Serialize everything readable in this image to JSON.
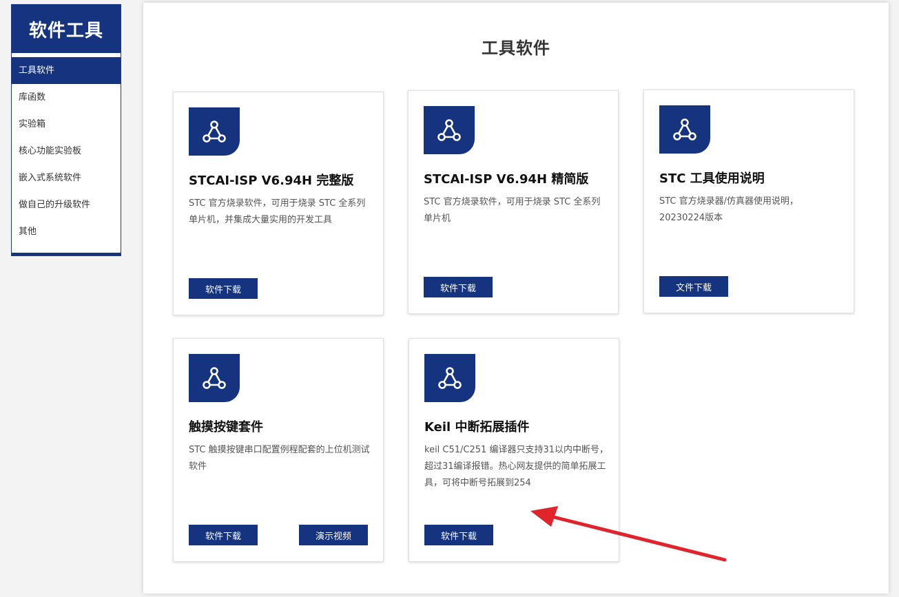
{
  "sidebar": {
    "title": "软件工具",
    "items": [
      {
        "label": "工具软件",
        "active": true
      },
      {
        "label": "库函数"
      },
      {
        "label": "实验箱"
      },
      {
        "label": "核心功能实验板"
      },
      {
        "label": "嵌入式系统软件"
      },
      {
        "label": "做自己的升级软件"
      },
      {
        "label": "其他"
      }
    ]
  },
  "main": {
    "title": "工具软件",
    "cards": [
      {
        "title": "STCAI-ISP V6.94H 完整版",
        "desc": "STC 官方烧录软件，可用于烧录 STC 全系列单片机，并集成大量实用的开发工具",
        "buttons": [
          "软件下载"
        ]
      },
      {
        "title": "STCAI-ISP V6.94H 精简版",
        "desc": "STC 官方烧录软件，可用于烧录 STC 全系列单片机",
        "buttons": [
          "软件下载"
        ]
      },
      {
        "title": "STC 工具使用说明",
        "desc": "STC 官方烧录器/仿真器使用说明，20230224版本",
        "buttons": [
          "文件下载"
        ]
      },
      {
        "title": "触摸按键套件",
        "desc": "STC 触摸按键串口配置例程配套的上位机测试软件",
        "buttons": [
          "软件下载",
          "演示视频"
        ]
      },
      {
        "title": "Keil 中断拓展插件",
        "desc": "keil C51/C251 编译器只支持31以内中断号，超过31编译报错。热心网友提供的简单拓展工具，可将中断号拓展到254",
        "buttons": [
          "软件下载"
        ]
      }
    ]
  },
  "colors": {
    "brand": "#15337f",
    "annotation_arrow": "#e0242b"
  },
  "icons": {
    "card_icon": "share-nodes-icon"
  }
}
